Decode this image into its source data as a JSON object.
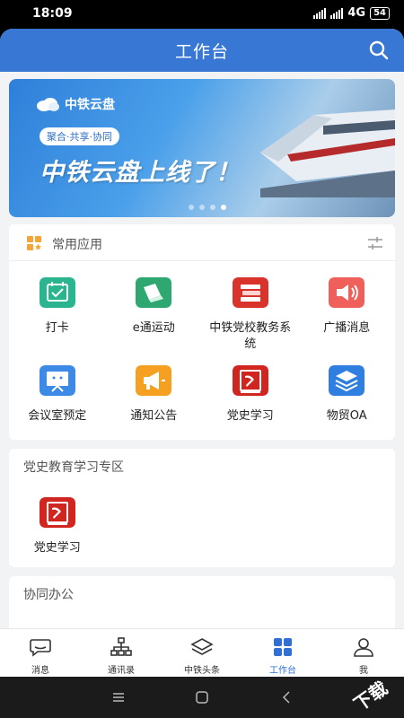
{
  "status": {
    "time": "18:09",
    "network": "4G",
    "battery": "54"
  },
  "header": {
    "title": "工作台"
  },
  "banner": {
    "brand": "中铁云盘",
    "tag": "聚合·共享·协同",
    "headline": "中铁云盘上线了！",
    "slide_count": 4,
    "active_slide": 4
  },
  "common_apps": {
    "title": "常用应用",
    "items": [
      {
        "label": "打卡",
        "icon": "calendar-check-icon",
        "color": "#2bb58e"
      },
      {
        "label": "e通运动",
        "icon": "running-shoe-icon",
        "color": "#2ea870"
      },
      {
        "label": "中铁党校教务系统",
        "icon": "books-icon",
        "color": "#d9342b"
      },
      {
        "label": "广播消息",
        "icon": "speaker-icon",
        "color": "#f0605a"
      },
      {
        "label": "会议室预定",
        "icon": "presentation-icon",
        "color": "#3c8ae6"
      },
      {
        "label": "通知公告",
        "icon": "megaphone-icon",
        "color": "#f5a020"
      },
      {
        "label": "党史学习",
        "icon": "party-book-icon",
        "color": "#d0261f"
      },
      {
        "label": "物贸OA",
        "icon": "layers-icon",
        "color": "#2f7fe0"
      }
    ]
  },
  "party_section": {
    "title": "党史教育学习专区",
    "items": [
      {
        "label": "党史学习",
        "icon": "party-book-icon",
        "color": "#d0261f"
      }
    ]
  },
  "collab_section": {
    "title": "协同办公"
  },
  "tabbar": {
    "items": [
      {
        "label": "消息",
        "icon": "chat-icon"
      },
      {
        "label": "通讯录",
        "icon": "org-chart-icon"
      },
      {
        "label": "中铁头条",
        "icon": "layers-outline-icon"
      },
      {
        "label": "工作台",
        "icon": "grid-icon"
      },
      {
        "label": "我",
        "icon": "user-icon"
      }
    ],
    "active": "工作台",
    "active_color": "#2f6fd6"
  },
  "watermark": "下载"
}
